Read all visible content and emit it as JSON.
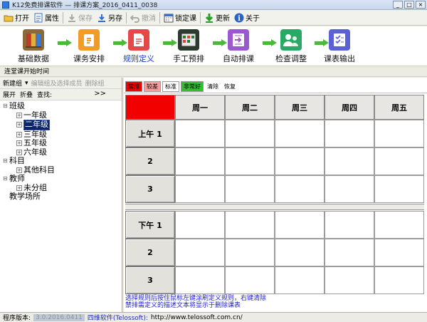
{
  "window": {
    "title": "K12免费排课软件 — 排课方案_2016_0411_0038",
    "buttons": [
      "_",
      "□",
      "×"
    ]
  },
  "toolbar": {
    "items": [
      {
        "label": "打开",
        "icon": "open-folder-icon",
        "enabled": true
      },
      {
        "label": "属性",
        "icon": "properties-icon",
        "enabled": true
      },
      {
        "label": "保存",
        "icon": "save-icon",
        "enabled": false
      },
      {
        "label": "另存",
        "icon": "save-as-icon",
        "enabled": true
      },
      {
        "label": "撤消",
        "icon": "undo-icon",
        "enabled": false
      },
      {
        "label": "锁定课",
        "icon": "lock-calendar-icon",
        "enabled": true
      },
      {
        "label": "更新",
        "icon": "update-icon",
        "enabled": true
      },
      {
        "label": "关于",
        "icon": "info-icon",
        "enabled": true
      }
    ]
  },
  "workflow": {
    "steps": [
      {
        "label": "基础数据",
        "icon": "database-icon",
        "active": false
      },
      {
        "label": "课务安排",
        "icon": "task-arrange-icon",
        "active": false
      },
      {
        "label": "规则定义",
        "icon": "rules-icon",
        "active": true
      },
      {
        "label": "手工预排",
        "icon": "manual-schedule-icon",
        "active": false
      },
      {
        "label": "自动排课",
        "icon": "auto-schedule-icon",
        "active": false
      },
      {
        "label": "检查调整",
        "icon": "check-adjust-icon",
        "active": false
      },
      {
        "label": "课表输出",
        "icon": "timetable-output-icon",
        "active": false
      }
    ]
  },
  "section": {
    "caption": "连堂课开始时间"
  },
  "left": {
    "toolbar1": {
      "new_group": "新建组",
      "edit_members": "编辑组及选择成员",
      "delete_group": "删除组"
    },
    "toolbar2": {
      "expand": "展开",
      "collapse": "折叠",
      "find": "查找:",
      "more": ">>"
    },
    "tree": [
      {
        "label": "班级",
        "level": 0,
        "expand": "⊟",
        "box": false,
        "selected": false
      },
      {
        "label": "一年级",
        "level": 1,
        "expand": "",
        "box": true,
        "selected": false
      },
      {
        "label": "二年级",
        "level": 1,
        "expand": "",
        "box": true,
        "selected": true
      },
      {
        "label": "三年级",
        "level": 1,
        "expand": "",
        "box": true,
        "selected": false
      },
      {
        "label": "五年级",
        "level": 1,
        "expand": "",
        "box": true,
        "selected": false
      },
      {
        "label": "六年级",
        "level": 1,
        "expand": "",
        "box": true,
        "selected": false
      },
      {
        "label": "科目",
        "level": 0,
        "expand": "⊟",
        "box": false,
        "selected": false
      },
      {
        "label": "其他科目",
        "level": 1,
        "expand": "",
        "box": true,
        "selected": false
      },
      {
        "label": "教师",
        "level": 0,
        "expand": "⊟",
        "box": false,
        "selected": false
      },
      {
        "label": "未分组",
        "level": 1,
        "expand": "",
        "box": true,
        "selected": false
      },
      {
        "label": "教学场所",
        "level": 0,
        "expand": "",
        "box": false,
        "selected": false
      }
    ]
  },
  "right": {
    "legend": [
      {
        "label": "禁排",
        "bg": "#f20000",
        "fg": "#000000"
      },
      {
        "label": "较差",
        "bg": "#f79c9c",
        "fg": "#000000"
      },
      {
        "label": "标准",
        "bg": "#ffffff",
        "fg": "#000000"
      },
      {
        "label": "非常好",
        "bg": "#2fbf2f",
        "fg": "#000000"
      },
      {
        "label": "清除",
        "bg": "",
        "fg": "#000000"
      },
      {
        "label": "恢复",
        "bg": "",
        "fg": "#000000"
      }
    ],
    "days": [
      "周一",
      "周二",
      "周三",
      "周四",
      "周五"
    ],
    "periods_am": [
      "上午 1",
      "2",
      "3"
    ],
    "periods_pm": [
      "下午 1",
      "2",
      "3"
    ],
    "notes": [
      "选择规则后按住鼠标左键涂刷定义规则，右键清除",
      "禁排需定义的描述文本将显示于删除课表"
    ]
  },
  "status": {
    "version_label": "程序版本:",
    "version_value": "3.0.2016.0411",
    "company": "四维软件(Telossoft):",
    "url": "http://www.telossoft.com.cn/"
  },
  "colors": {
    "accent_blue": "#1a3cc8",
    "flow_arrow": "#4cb83a",
    "forbidden_red": "#f20000"
  }
}
